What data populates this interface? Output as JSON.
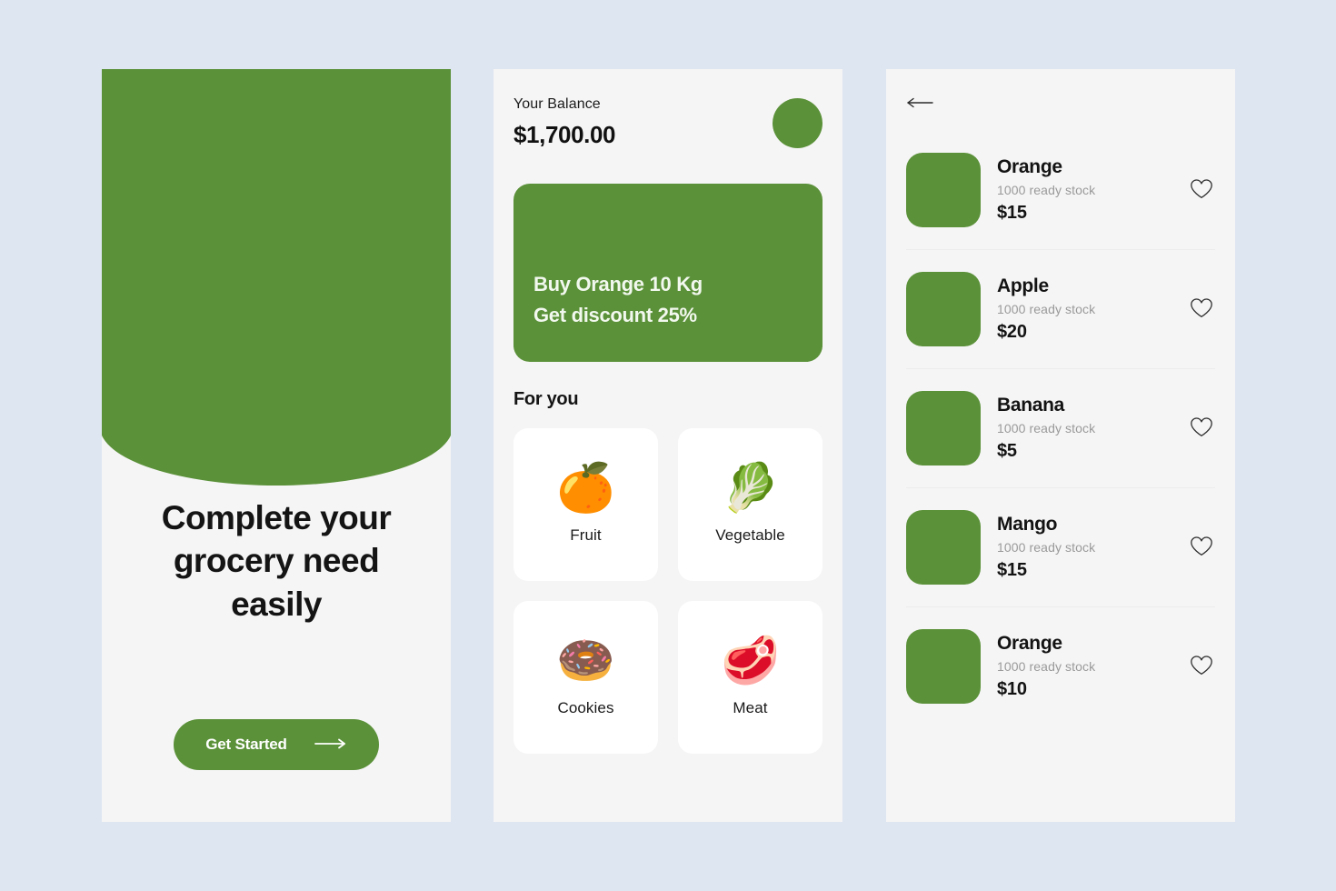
{
  "theme": {
    "page_background": "#dee6f2",
    "brand_green": "#5b9139",
    "panel_background": "#f5f5f5",
    "card_background": "#ffffff",
    "muted_text": "#9a9a9a"
  },
  "onboarding": {
    "title": "Complete your grocery need easily",
    "cta_label": "Get Started",
    "cta_icon": "arrow-right-icon",
    "hero_icon": "hero-illustration"
  },
  "home": {
    "balance_label": "Your Balance",
    "balance_amount": "$1,700.00",
    "avatar_icon": "avatar-circle",
    "promo": {
      "line1": "Buy Orange 10 Kg",
      "line2": "Get discount 25%"
    },
    "section_title": "For you",
    "categories": [
      {
        "label": "Fruit",
        "icon": "orange-fruit-icon",
        "emoji": "🍊"
      },
      {
        "label": "Vegetable",
        "icon": "leafy-green-icon",
        "emoji": "🥬"
      },
      {
        "label": "Cookies",
        "icon": "donut-icon",
        "emoji": "🍩"
      },
      {
        "label": "Meat",
        "icon": "meat-cut-icon",
        "emoji": "🥩"
      }
    ]
  },
  "products": {
    "back_icon": "arrow-left-icon",
    "favorite_icon": "heart-outline-icon",
    "items": [
      {
        "name": "Orange",
        "stock": "1000 ready stock",
        "price": "$15"
      },
      {
        "name": "Apple",
        "stock": "1000 ready stock",
        "price": "$20"
      },
      {
        "name": "Banana",
        "stock": "1000 ready stock",
        "price": "$5"
      },
      {
        "name": "Mango",
        "stock": "1000 ready stock",
        "price": "$15"
      },
      {
        "name": "Orange",
        "stock": "1000 ready stock",
        "price": "$10"
      }
    ]
  }
}
